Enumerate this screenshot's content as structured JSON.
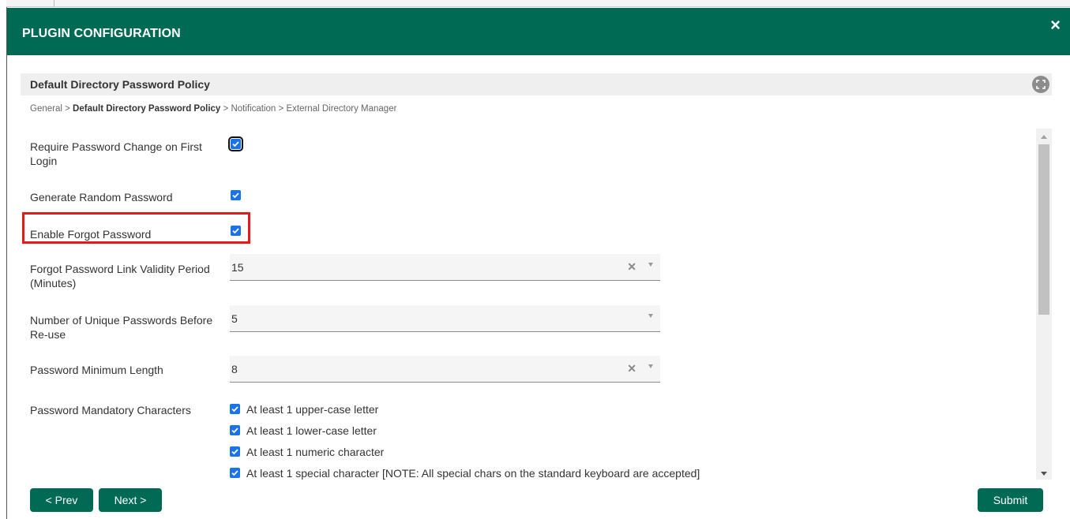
{
  "modal": {
    "title": "PLUGIN CONFIGURATION",
    "close_label": "×"
  },
  "section": {
    "title": "Default Directory Password Policy"
  },
  "breadcrumb": {
    "items": [
      "General",
      "Default Directory Password Policy",
      "Notification",
      "External Directory Manager"
    ],
    "separator": ">"
  },
  "form": {
    "require_change": {
      "label": "Require Password Change on First Login",
      "checked": true
    },
    "generate_random": {
      "label": "Generate Random Password",
      "checked": true
    },
    "forgot_password": {
      "label": "Enable Forgot Password",
      "checked": true
    },
    "link_validity": {
      "label": "Forgot Password Link Validity Period (Minutes)",
      "value": "15",
      "clear": "✕"
    },
    "unique_passwords": {
      "label": "Number of Unique Passwords Before Re-use",
      "value": "5"
    },
    "min_length": {
      "label": "Password Minimum Length",
      "value": "8",
      "clear": "✕"
    },
    "mandatory": {
      "label": "Password Mandatory Characters",
      "options": [
        "At least 1 upper-case letter",
        "At least 1 lower-case letter",
        "At least 1 numeric character",
        "At least 1 special character [NOTE: All special chars on the standard keyboard are accepted]"
      ]
    }
  },
  "footer": {
    "prev_label": "< Prev",
    "next_label": "Next >",
    "submit_label": "Submit"
  },
  "colors": {
    "header": "#006a55",
    "checkbox": "#1a73e8",
    "highlight": "#e21b1b",
    "button": "#006a55"
  }
}
